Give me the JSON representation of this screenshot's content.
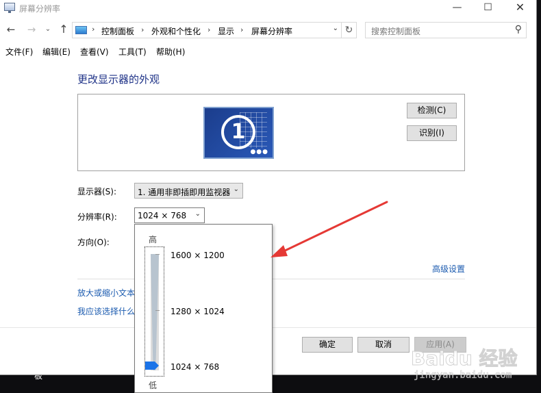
{
  "window": {
    "title": "屏幕分辨率",
    "minimize": "—",
    "maximize": "☐",
    "close": "✕"
  },
  "nav": {
    "back": "←",
    "forward": "→",
    "recent": "⌄",
    "up": "↑",
    "breadcrumbs": [
      "控制面板",
      "外观和个性化",
      "显示",
      "屏幕分辨率"
    ],
    "crumb_sep": "›",
    "refresh": "↻",
    "search_placeholder": "搜索控制面板",
    "search_icon": "⚲"
  },
  "menu": {
    "items": [
      "文件(F)",
      "编辑(E)",
      "查看(V)",
      "工具(T)",
      "帮助(H)"
    ]
  },
  "main": {
    "title": "更改显示器的外观",
    "monitor_number": "1",
    "detect_button": "检测(C)",
    "identify_button": "识别(I)",
    "display_label": "显示器(S):",
    "display_value": "1. 通用非即插即用监视器",
    "resolution_label": "分辨率(R):",
    "resolution_value": "1024 × 768",
    "orientation_label": "方向(O):",
    "advanced_link": "高级设置",
    "link1": "放大或缩小文本",
    "link2": "我应该选择什么"
  },
  "popup": {
    "high_label": "高",
    "low_label": "低",
    "options": [
      "1600 × 1200",
      "1280 × 1024",
      "1024 × 768"
    ],
    "selected": "1024 × 768"
  },
  "footer": {
    "ok": "确定",
    "cancel": "取消",
    "apply": "应用(A)"
  },
  "desktop_text": "板",
  "watermark": {
    "logo": "Baidu 经验",
    "url": "jingyan.baidu.com"
  },
  "colors": {
    "title_blue": "#1e3287",
    "link_blue": "#1a5aaf",
    "annotation_red": "#e53935"
  }
}
